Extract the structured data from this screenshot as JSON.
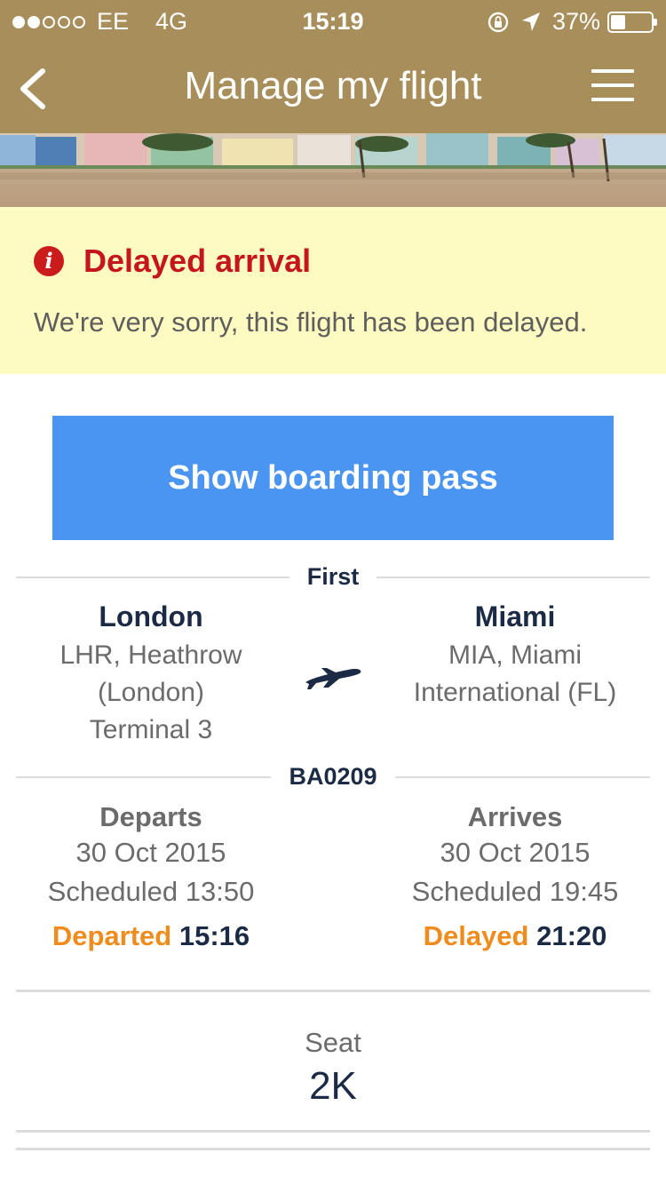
{
  "status_bar": {
    "carrier": "EE",
    "network": "4G",
    "time": "15:19",
    "battery": "37%",
    "signal_bars": 2,
    "signal_total": 5
  },
  "nav": {
    "title": "Manage my flight",
    "back_icon": "chevron-left-icon",
    "menu_icon": "hamburger-menu-icon"
  },
  "alert": {
    "heading": "Delayed arrival",
    "message": "We're very sorry, this flight has been delayed.",
    "icon": "info-icon",
    "icon_glyph": "i"
  },
  "boarding_pass_button": "Show boarding pass",
  "cabin": "First",
  "origin": {
    "city": "London",
    "airport_lines": [
      "LHR, Heathrow",
      "(London)",
      "Terminal 3"
    ]
  },
  "destination": {
    "city": "Miami",
    "airport_lines": [
      "MIA, Miami",
      "International (FL)"
    ]
  },
  "flight_number": "BA0209",
  "departure": {
    "heading": "Departs",
    "date": "30 Oct 2015",
    "scheduled": "Scheduled 13:50",
    "status": "Departed",
    "status_time": "15:16"
  },
  "arrival": {
    "heading": "Arrives",
    "date": "30 Oct 2015",
    "scheduled": "Scheduled 19:45",
    "status": "Delayed",
    "status_time": "21:20"
  },
  "seat": {
    "label": "Seat",
    "value": "2K"
  },
  "colors": {
    "header": "#a88e5b",
    "alert_bg": "#fdfbc1",
    "alert_red": "#c4161c",
    "button_blue": "#4a94f2",
    "navy": "#1c2b45",
    "orange": "#f08c1d"
  }
}
